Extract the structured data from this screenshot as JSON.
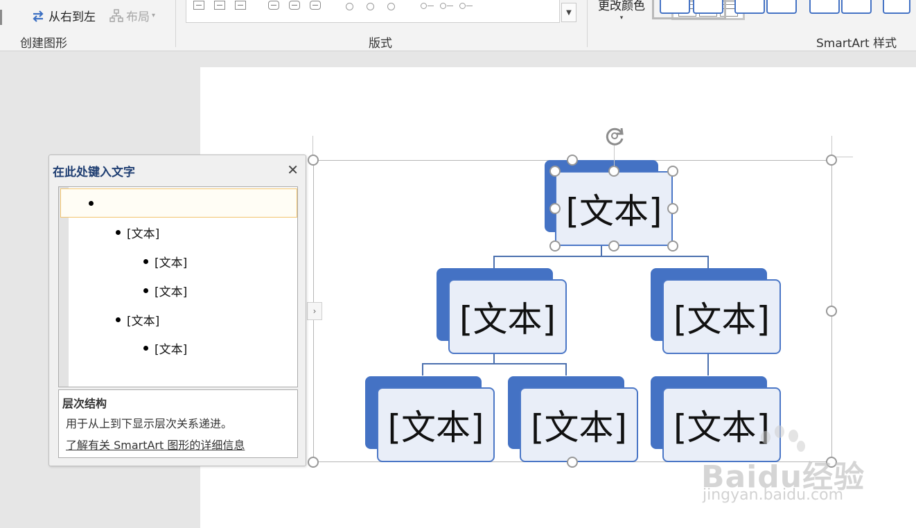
{
  "ribbon": {
    "create_graphic": {
      "right_to_left_label": "从右到左",
      "layout_label": "布局",
      "group_label": "创建图形"
    },
    "layouts": {
      "group_label": "版式"
    },
    "smartart_styles": {
      "change_colors_label": "更改颜色",
      "group_label": "SmartArt 样式"
    }
  },
  "text_pane": {
    "title": "在此处键入文字",
    "close_icon": "close-icon",
    "items": [
      {
        "level": 1,
        "text": ""
      },
      {
        "level": 2,
        "text": "[文本]"
      },
      {
        "level": 3,
        "text": "[文本]"
      },
      {
        "level": 3,
        "text": "[文本]"
      },
      {
        "level": 2,
        "text": "[文本]"
      },
      {
        "level": 3,
        "text": "[文本]"
      }
    ],
    "description_title": "层次结构",
    "description_text": "用于从上到下显示层次关系递进。",
    "learn_more_link": "了解有关 SmartArt 图形的详细信息"
  },
  "smartart": {
    "nodes": [
      {
        "id": "top",
        "text": "[文本]"
      },
      {
        "id": "level2-left",
        "text": "[文本]"
      },
      {
        "id": "level2-right",
        "text": "[文本]"
      },
      {
        "id": "level3-left-a",
        "text": "[文本]"
      },
      {
        "id": "level3-left-b",
        "text": "[文本]"
      },
      {
        "id": "level3-right",
        "text": "[文本]"
      }
    ],
    "fill_color": "#4472c4",
    "text_box_color": "#e9eef8"
  },
  "watermark": {
    "logo_text": "Baidu经验",
    "url": "jingyan.baidu.com"
  }
}
